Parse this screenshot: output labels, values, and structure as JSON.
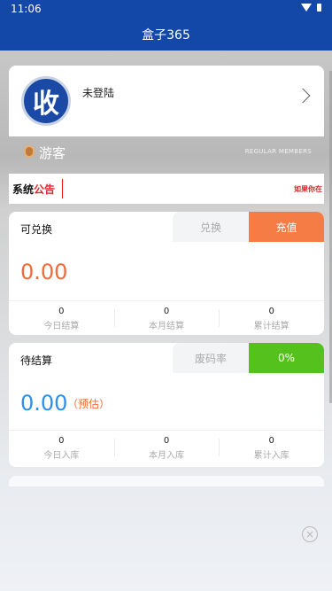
{
  "status_bar": {
    "time": "11:06"
  },
  "header": {
    "title": "盒子365"
  },
  "profile": {
    "avatar_char": "收",
    "login_status": "未登陆"
  },
  "member": {
    "level_name": "游客",
    "tier_label": "REGULAR MEMBERS"
  },
  "notice": {
    "label_black": "系统",
    "label_red": "公告",
    "scrolling_text": "如果你在"
  },
  "exchange_card": {
    "title": "可兑换",
    "btn_exchange": "兑换",
    "btn_recharge": "充值",
    "amount": "0.00",
    "stats": [
      {
        "value": "0",
        "label": "今日结算"
      },
      {
        "value": "0",
        "label": "本月结算"
      },
      {
        "value": "0",
        "label": "累计结算"
      }
    ]
  },
  "pending_card": {
    "title": "待结算",
    "label_rate": "废码率",
    "rate_value": "0%",
    "amount": "0.00",
    "estimate_label": "（预估）",
    "stats": [
      {
        "value": "0",
        "label": "今日入库"
      },
      {
        "value": "0",
        "label": "本月入库"
      },
      {
        "value": "0",
        "label": "累计入库"
      }
    ]
  },
  "colors": {
    "header_blue": "#1448a8",
    "accent_orange": "#f57d45",
    "accent_green": "#55c11d",
    "amount_blue": "#2c8ff0",
    "notice_red": "#e0262a"
  },
  "icons": [
    "wifi-icon",
    "battery-icon",
    "chevron-right-icon",
    "medal-icon",
    "close-icon"
  ]
}
